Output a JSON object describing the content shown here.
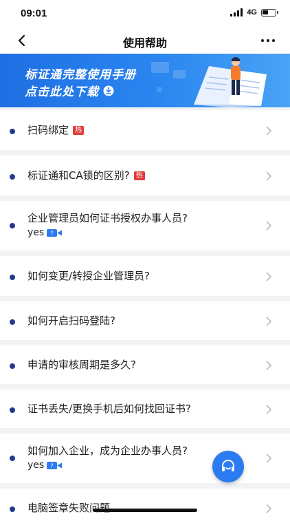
{
  "status_bar": {
    "time": "09:01",
    "network": "4G",
    "battery_level": 0.45
  },
  "nav": {
    "title": "使用帮助",
    "back_icon": "chevron-left-icon",
    "more_icon": "more-icon"
  },
  "banner": {
    "title": "标证通完整使用手册",
    "subtitle": "点击此处下载",
    "download_icon": "download-icon"
  },
  "help_items": [
    {
      "text": "扫码绑定",
      "tag": "热"
    },
    {
      "text": "标证通和CA锁的区别?",
      "tag": "热"
    },
    {
      "text": "企业管理员如何证书授权办事人员?",
      "extra": "yes"
    },
    {
      "text": "如何变更/转授企业管理员?"
    },
    {
      "text": "如何开启扫码登陆?"
    },
    {
      "text": "申请的审核周期是多久?"
    },
    {
      "text": "证书丢失/更换手机后如何找回证书?"
    },
    {
      "text": "如何加入企业，成为企业办事人员?",
      "extra": "yes"
    },
    {
      "text": "电脑签章失败问题"
    }
  ],
  "colors": {
    "accent": "#2d7bf0",
    "dot": "#23388f",
    "hot_tag": "#e03a3a",
    "background": "#f2f3f5"
  }
}
